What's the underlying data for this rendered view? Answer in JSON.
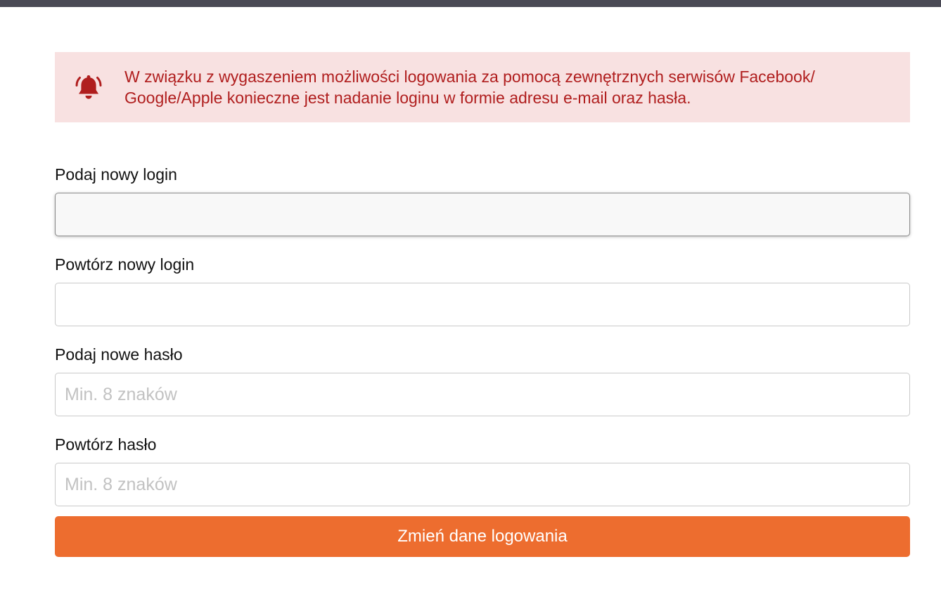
{
  "alert": {
    "icon": "bell-ringing-icon",
    "color": "#b01e1e",
    "background": "#f8e1e1",
    "text": "W związku z wygaszeniem możliwości logowania za pomocą zewnętrznych serwisów Facebook/ Google/Apple konieczne jest nadanie loginu w formie adresu e-mail oraz hasła."
  },
  "form": {
    "new_login": {
      "label": "Podaj nowy login",
      "value": "",
      "placeholder": ""
    },
    "repeat_login": {
      "label": "Powtórz nowy login",
      "value": "",
      "placeholder": ""
    },
    "new_password": {
      "label": "Podaj nowe hasło",
      "value": "",
      "placeholder": "Min. 8 znaków"
    },
    "repeat_password": {
      "label": "Powtórz hasło",
      "value": "",
      "placeholder": "Min. 8 znaków"
    },
    "submit_label": "Zmień dane logowania",
    "submit_color": "#ed6d2f"
  }
}
